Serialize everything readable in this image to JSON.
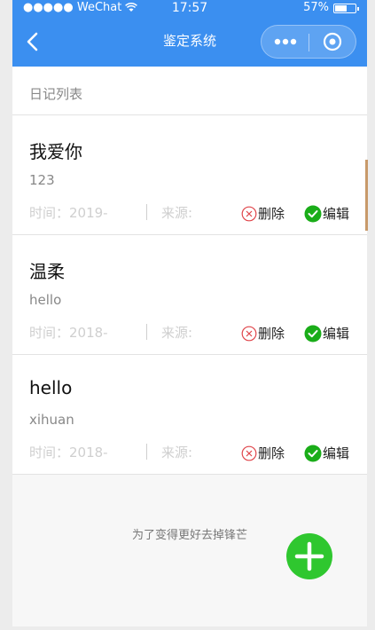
{
  "status_bar": {
    "signal": "●●●●● WeChat",
    "time": "17:57",
    "battery_text": "57%",
    "battery_level": 0.57
  },
  "nav": {
    "title": "鉴定系统"
  },
  "list": {
    "header": "日记列表",
    "entries": [
      {
        "title": "我爱你",
        "body": "123",
        "time": "时间：2019-",
        "source": "来源:",
        "delete_label": "删除",
        "edit_label": "编辑"
      },
      {
        "title": "温柔",
        "body": "hello",
        "time": "时间：2018-",
        "source": "来源:",
        "delete_label": "删除",
        "edit_label": "编辑"
      },
      {
        "title": "hello",
        "body": "xihuan",
        "time": "时间：2018-",
        "source": "来源:",
        "delete_label": "删除",
        "edit_label": "编辑"
      }
    ]
  },
  "footer": {
    "slogan": "为了变得更好去掉锋芒"
  },
  "icons": {
    "back": "chevron-left-icon",
    "more": "more-dots-icon",
    "target": "target-icon",
    "delete": "close-circle-icon",
    "edit": "check-circle-icon",
    "add": "plus-icon"
  },
  "colors": {
    "primary": "#3b8ff0",
    "delete": "#e0454a",
    "edit": "#1aad19",
    "fab": "#2fc72f"
  }
}
